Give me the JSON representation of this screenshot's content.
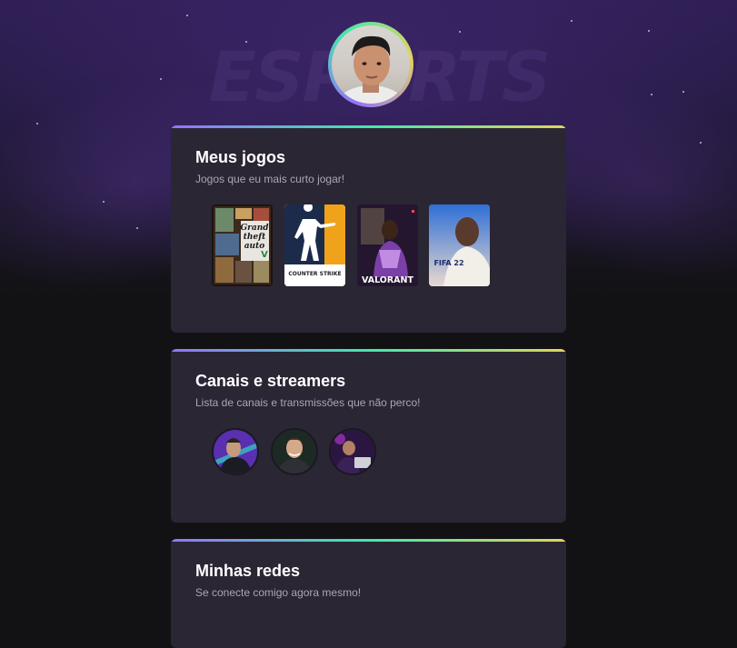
{
  "background": {
    "watermark_text": "ESPORTS"
  },
  "profile": {
    "avatar_icon": "user-avatar"
  },
  "games_card": {
    "title": "Meus jogos",
    "subtitle": "Jogos que eu mais curto jogar!",
    "games": [
      {
        "name": "Grand Theft Auto V",
        "cover_lines": [
          "Grand",
          "theft",
          "auto",
          "V"
        ]
      },
      {
        "name": "Counter-Strike",
        "cover_text": "COUNTER STRIKE"
      },
      {
        "name": "Valorant",
        "cover_text": "VALORANT"
      },
      {
        "name": "FIFA 22",
        "cover_text": "FIFA 22"
      }
    ]
  },
  "streamers_card": {
    "title": "Canais e streamers",
    "subtitle": "Lista de canais e transmissões que não perco!",
    "streamers": [
      {
        "icon": "streamer-avatar-1"
      },
      {
        "icon": "streamer-avatar-2"
      },
      {
        "icon": "streamer-avatar-3"
      }
    ]
  },
  "networks_card": {
    "title": "Minhas redes",
    "subtitle": "Se conecte comigo agora mesmo!"
  },
  "colors": {
    "page_bg": "#121214",
    "card_bg": "#2a2634",
    "gradient_start": "#9572fc",
    "gradient_mid": "#43e7ad",
    "gradient_end": "#e2d45c"
  }
}
